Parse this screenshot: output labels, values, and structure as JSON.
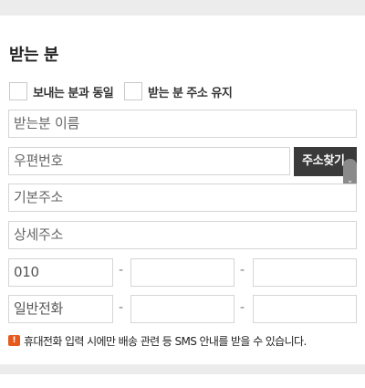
{
  "section": {
    "title": "받는 분"
  },
  "options": {
    "same_as_sender": "보내는 분과 동일",
    "keep_address": "받는 분 주소 유지"
  },
  "fields": {
    "recipient_name": "받는분 이름",
    "postal_code": "우편번호",
    "address_search_button": "주소찾기",
    "basic_address": "기본주소",
    "detail_address": "상세주소",
    "mobile_prefix": "010",
    "phone_prefix": "일반전화",
    "separator": "-"
  },
  "notice": {
    "text": "휴대전화 입력 시에만 배송 관련 등 SMS 안내를 받을 수 있습니다."
  },
  "colors": {
    "accent": "#e65a1e",
    "button": "#3a3a3a",
    "border": "#d5d5d5",
    "band": "#ececec"
  }
}
